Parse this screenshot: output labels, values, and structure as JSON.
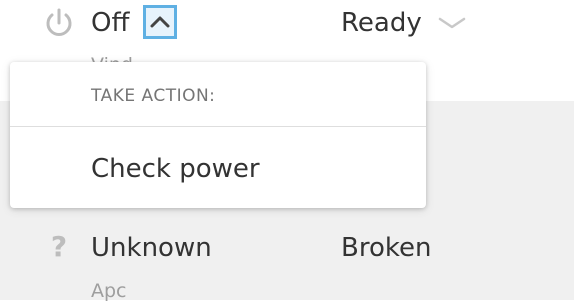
{
  "rows": [
    {
      "icon": "power-icon",
      "status": "Off",
      "sub_label": "Vind",
      "state": "Ready",
      "state_chevron": "chevron-down-icon",
      "expand_icon": "chevron-up-icon"
    },
    {
      "icon": "question-icon",
      "icon_glyph": "?",
      "status": "Unknown",
      "sub_label": "Apc",
      "state": "Broken"
    }
  ],
  "popover": {
    "header": "TAKE ACTION:",
    "items": [
      "Check power"
    ]
  },
  "colors": {
    "focus_outline": "#5fb0e3",
    "row_highlight": "#f0f0f0",
    "icon_gray": "#bdbdbd"
  }
}
